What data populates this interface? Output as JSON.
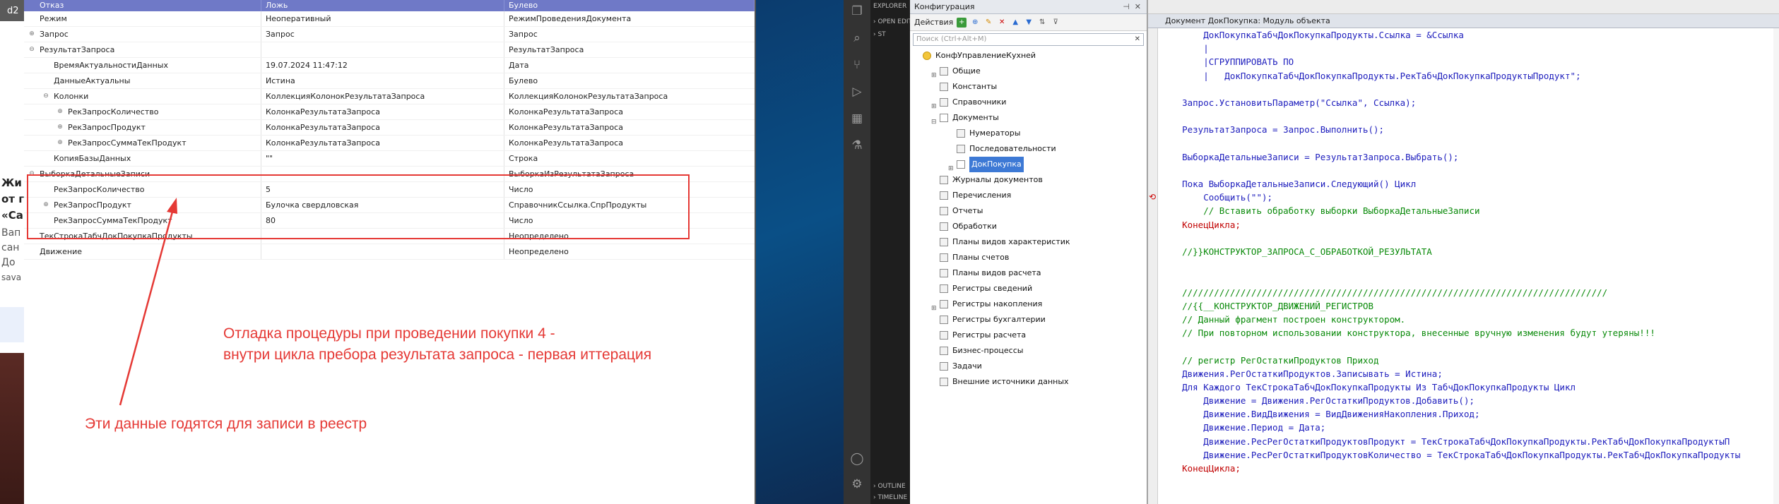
{
  "browser_strip": {
    "tab_text": "d2",
    "news_lines": [
      "Жи",
      "от г",
      "«Са"
    ],
    "sub_lines": [
      "Вап",
      "сан",
      "До"
    ],
    "author": "sava"
  },
  "debugger": {
    "columns": [
      "Отказ",
      "Ложь",
      "Булево"
    ],
    "rows": [
      {
        "name": "Режим",
        "value": "Неоперативный",
        "type": "РежимПроведенияДокумента",
        "level": 0,
        "toggle": ""
      },
      {
        "name": "Запрос",
        "value": "Запрос",
        "type": "Запрос",
        "level": 0,
        "toggle": "+"
      },
      {
        "name": "РезультатЗапроса",
        "value": "",
        "type": "РезультатЗапроса",
        "level": 0,
        "toggle": "−"
      },
      {
        "name": "ВремяАктуальностиДанных",
        "value": "19.07.2024 11:47:12",
        "type": "Дата",
        "level": 1,
        "toggle": ""
      },
      {
        "name": "ДанныеАктуальны",
        "value": "Истина",
        "type": "Булево",
        "level": 1,
        "toggle": ""
      },
      {
        "name": "Колонки",
        "value": "КоллекцияКолонокРезультатаЗапроса",
        "type": "КоллекцияКолонокРезультатаЗапроса",
        "level": 1,
        "toggle": "−"
      },
      {
        "name": "РекЗапросКоличество",
        "value": "КолонкаРезультатаЗапроса",
        "type": "КолонкаРезультатаЗапроса",
        "level": 2,
        "toggle": "+"
      },
      {
        "name": "РекЗапросПродукт",
        "value": "КолонкаРезультатаЗапроса",
        "type": "КолонкаРезультатаЗапроса",
        "level": 2,
        "toggle": "+"
      },
      {
        "name": "РекЗапросСуммаТекПродукт",
        "value": "КолонкаРезультатаЗапроса",
        "type": "КолонкаРезультатаЗапроса",
        "level": 2,
        "toggle": "+"
      },
      {
        "name": "КопияБазыДанных",
        "value": "\"\"",
        "type": "Строка",
        "level": 1,
        "toggle": ""
      },
      {
        "name": "ВыборкаДетальныеЗаписи",
        "value": "",
        "type": "ВыборкаИзРезультатаЗапроса",
        "level": 0,
        "toggle": "−"
      },
      {
        "name": "РекЗапросКоличество",
        "value": "5",
        "type": "Число",
        "level": 1,
        "toggle": ""
      },
      {
        "name": "РекЗапросПродукт",
        "value": "Булочка свердловская",
        "type": "СправочникСсылка.СпрПродукты",
        "level": 1,
        "toggle": "+"
      },
      {
        "name": "РекЗапросСуммаТекПродукт",
        "value": "80",
        "type": "Число",
        "level": 1,
        "toggle": ""
      },
      {
        "name": "ТекСтрокаТабчДокПокупкаПродукты",
        "value": "",
        "type": "Неопределено",
        "level": 0,
        "toggle": ""
      },
      {
        "name": "Движение",
        "value": "",
        "type": "Неопределено",
        "level": 0,
        "toggle": ""
      }
    ]
  },
  "annotations": {
    "line1": "Отладка процедуры при проведении покупки 4 -",
    "line2": "внутри цикла пребора результата запроса - первая иттерация",
    "note": "Эти данные годятся для записи в реестр",
    "color": "#e53935"
  },
  "vscode": {
    "explorer": "EXPLORER",
    "open_editors": "OPEN EDITORS",
    "folder": "ST",
    "outline": "OUTLINE",
    "timeline": "TIMELINE"
  },
  "config": {
    "title": "Конфигурация",
    "actions_label": "Действия",
    "search_placeholder": "Поиск (Ctrl+Alt+M)",
    "tree": [
      {
        "label": "КонфУправлениеКухней",
        "level": 0,
        "expander": "",
        "icon": "config-icon"
      },
      {
        "label": "Общие",
        "level": 1,
        "expander": "⊞",
        "icon": "common-icon"
      },
      {
        "label": "Константы",
        "level": 1,
        "expander": "",
        "icon": "constants-icon"
      },
      {
        "label": "Справочники",
        "level": 1,
        "expander": "⊞",
        "icon": "catalogs-icon"
      },
      {
        "label": "Документы",
        "level": 1,
        "expander": "⊟",
        "icon": "documents-icon"
      },
      {
        "label": "Нумераторы",
        "level": 2,
        "expander": "",
        "icon": "numerators-icon"
      },
      {
        "label": "Последовательности",
        "level": 2,
        "expander": "",
        "icon": "sequences-icon"
      },
      {
        "label": "ДокПокупка",
        "level": 2,
        "expander": "⊞",
        "icon": "document-icon",
        "selected": true
      },
      {
        "label": "Журналы документов",
        "level": 1,
        "expander": "",
        "icon": "journals-icon"
      },
      {
        "label": "Перечисления",
        "level": 1,
        "expander": "",
        "icon": "enums-icon"
      },
      {
        "label": "Отчеты",
        "level": 1,
        "expander": "",
        "icon": "reports-icon"
      },
      {
        "label": "Обработки",
        "level": 1,
        "expander": "",
        "icon": "dataprocessors-icon"
      },
      {
        "label": "Планы видов характеристик",
        "level": 1,
        "expander": "",
        "icon": "chart-types-icon"
      },
      {
        "label": "Планы счетов",
        "level": 1,
        "expander": "",
        "icon": "chart-accounts-icon"
      },
      {
        "label": "Планы видов расчета",
        "level": 1,
        "expander": "",
        "icon": "calc-types-icon"
      },
      {
        "label": "Регистры сведений",
        "level": 1,
        "expander": "",
        "icon": "info-registers-icon"
      },
      {
        "label": "Регистры накопления",
        "level": 1,
        "expander": "⊞",
        "icon": "accum-registers-icon"
      },
      {
        "label": "Регистры бухгалтерии",
        "level": 1,
        "expander": "",
        "icon": "acct-registers-icon"
      },
      {
        "label": "Регистры расчета",
        "level": 1,
        "expander": "",
        "icon": "calc-registers-icon"
      },
      {
        "label": "Бизнес-процессы",
        "level": 1,
        "expander": "",
        "icon": "business-processes-icon"
      },
      {
        "label": "Задачи",
        "level": 1,
        "expander": "",
        "icon": "tasks-icon"
      },
      {
        "label": "Внешние источники данных",
        "level": 1,
        "expander": "",
        "icon": "external-sources-icon"
      }
    ]
  },
  "code": {
    "title": "Документ ДокПокупка: Модуль объекта",
    "lines": [
      {
        "t": "        ДокПокупкаТабчДокПокупкаПродукты.Ссылка = &Ссылка",
        "c": "b"
      },
      {
        "t": "        |",
        "c": "b"
      },
      {
        "t": "        |СГРУППИРОВАТЬ ПО",
        "c": "b"
      },
      {
        "t": "        |   ДокПокупкаТабчДокПокупкаПродукты.РекТабчДокПокупкаПродуктыПродукт\";",
        "c": "b"
      },
      {
        "t": "",
        "c": ""
      },
      {
        "t": "    Запрос.УстановитьПараметр(\"Ссылка\", Ссылка);",
        "c": "b"
      },
      {
        "t": "",
        "c": ""
      },
      {
        "t": "    РезультатЗапроса = Запрос.Выполнить();",
        "c": "b"
      },
      {
        "t": "",
        "c": ""
      },
      {
        "t": "    ВыборкаДетальныеЗаписи = РезультатЗапроса.Выбрать();",
        "c": "b"
      },
      {
        "t": "",
        "c": ""
      },
      {
        "t": "    Пока ВыборкаДетальныеЗаписи.Следующий() Цикл",
        "c": "b"
      },
      {
        "t": "        Сообщить(\"\");",
        "c": "b"
      },
      {
        "t": "        // Вставить обработку выборки ВыборкаДетальныеЗаписи",
        "c": "g"
      },
      {
        "t": "    КонецЦикла;",
        "c": "r"
      },
      {
        "t": "",
        "c": ""
      },
      {
        "t": "    //}}КОНСТРУКТОР_ЗАПРОСА_С_ОБРАБОТКОЙ_РЕЗУЛЬТАТА",
        "c": "g"
      },
      {
        "t": "",
        "c": ""
      },
      {
        "t": "",
        "c": ""
      },
      {
        "t": "    ////////////////////////////////////////////////////////////////////////////////",
        "c": "g"
      },
      {
        "t": "    //{{__КОНСТРУКТОР_ДВИЖЕНИЙ_РЕГИСТРОВ",
        "c": "g"
      },
      {
        "t": "    // Данный фрагмент построен конструктором.",
        "c": "g"
      },
      {
        "t": "    // При повторном использовании конструктора, внесенные вручную изменения будут утеряны!!!",
        "c": "g"
      },
      {
        "t": "",
        "c": ""
      },
      {
        "t": "    // регистр РегОстаткиПродуктов Приход",
        "c": "g"
      },
      {
        "t": "    Движения.РегОстаткиПродуктов.Записывать = Истина;",
        "c": "b"
      },
      {
        "t": "    Для Каждого ТекСтрокаТабчДокПокупкаПродукты Из ТабчДокПокупкаПродукты Цикл",
        "c": "b"
      },
      {
        "t": "        Движение = Движения.РегОстаткиПродуктов.Добавить();",
        "c": "b"
      },
      {
        "t": "        Движение.ВидДвижения = ВидДвиженияНакопления.Приход;",
        "c": "b"
      },
      {
        "t": "        Движение.Период = Дата;",
        "c": "b"
      },
      {
        "t": "        Движение.РесРегОстаткиПродуктовПродукт = ТекСтрокаТабчДокПокупкаПродукты.РекТабчДокПокупкаПродуктыП",
        "c": "b"
      },
      {
        "t": "        Движение.РесРегОстаткиПродуктовКоличество = ТекСтрокаТабчДокПокупкаПродукты.РекТабчДокПокупкаПродукты",
        "c": "b"
      },
      {
        "t": "    КонецЦикла;",
        "c": "r"
      }
    ]
  }
}
